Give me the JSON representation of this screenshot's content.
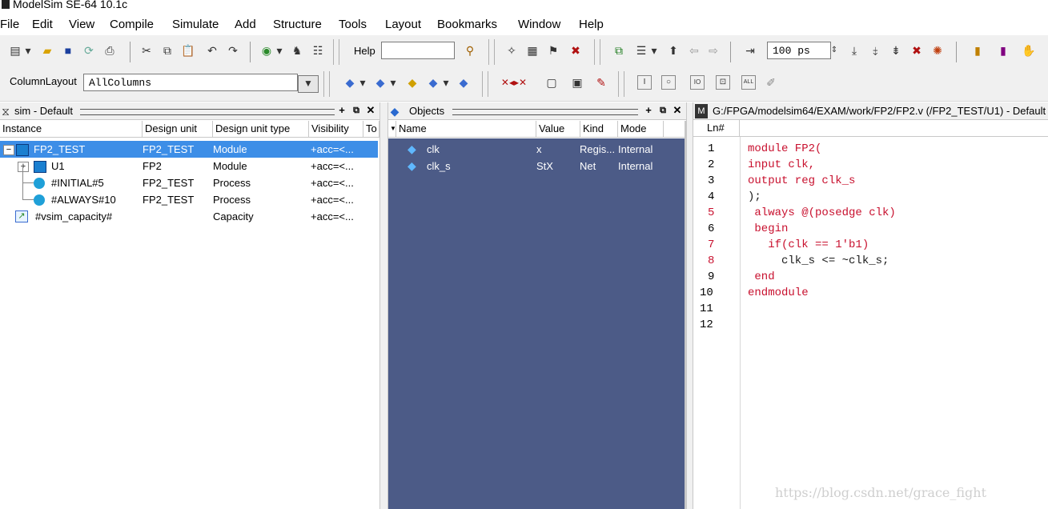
{
  "window": {
    "title": "ModelSim SE-64 10.1c"
  },
  "menu": [
    "File",
    "Edit",
    "View",
    "Compile",
    "Simulate",
    "Add",
    "Structure",
    "Tools",
    "Layout",
    "Bookmarks",
    "Window",
    "Help"
  ],
  "toolbar": {
    "help_label": "Help",
    "help_value": "",
    "time_value": "100 ps",
    "column_layout_label": "ColumnLayout",
    "column_layout_value": "AllColumns"
  },
  "sim_pane": {
    "title": "sim - Default",
    "columns": [
      "Instance",
      "Design unit",
      "Design unit type",
      "Visibility",
      "To"
    ],
    "rows": [
      {
        "instance": "FP2_TEST",
        "design_unit": "FP2_TEST",
        "type": "Module",
        "visibility": "+acc=<...",
        "icon": "module-icon",
        "expander": "−",
        "selected": true
      },
      {
        "instance": "U1",
        "design_unit": "FP2",
        "type": "Module",
        "visibility": "+acc=<...",
        "icon": "module-icon",
        "expander": "+",
        "selected": false
      },
      {
        "instance": "#INITIAL#5",
        "design_unit": "FP2_TEST",
        "type": "Process",
        "visibility": "+acc=<...",
        "icon": "process-icon",
        "expander": "",
        "selected": false
      },
      {
        "instance": "#ALWAYS#10",
        "design_unit": "FP2_TEST",
        "type": "Process",
        "visibility": "+acc=<...",
        "icon": "process-icon",
        "expander": "",
        "selected": false
      },
      {
        "instance": "#vsim_capacity#",
        "design_unit": "",
        "type": "Capacity",
        "visibility": "+acc=<...",
        "icon": "capacity-icon",
        "expander": "",
        "selected": false
      }
    ]
  },
  "objects_pane": {
    "title": "Objects",
    "columns": [
      "Name",
      "Value",
      "Kind",
      "Mode"
    ],
    "rows": [
      {
        "name": "clk",
        "value": "x",
        "kind": "Regis...",
        "mode": "Internal"
      },
      {
        "name": "clk_s",
        "value": "StX",
        "kind": "Net",
        "mode": "Internal"
      }
    ]
  },
  "source_pane": {
    "title": "G:/FPGA/modelsim64/EXAM/work/FP2/FP2.v (/FP2_TEST/U1) - Default",
    "ln_header": "Ln#",
    "lines": [
      "module FP2(",
      "input clk,",
      "output reg clk_s",
      ");",
      " always @(posedge clk)",
      " begin",
      "   if(clk == 1'b1)",
      "     clk_s <= ~clk_s;",
      " end",
      "endmodule",
      "",
      ""
    ],
    "line_numbers": [
      "1",
      "2",
      "3",
      "4",
      "5",
      "6",
      "7",
      "8",
      "9",
      "10",
      "11",
      "12"
    ]
  },
  "watermark": "https://blog.csdn.net/grace_fight",
  "colors": {
    "selection": "#3d8ee7",
    "objects_bg": "#4c5b87",
    "keyword_red": "#c8102e",
    "keyword_blue": "#1a7fd0"
  }
}
